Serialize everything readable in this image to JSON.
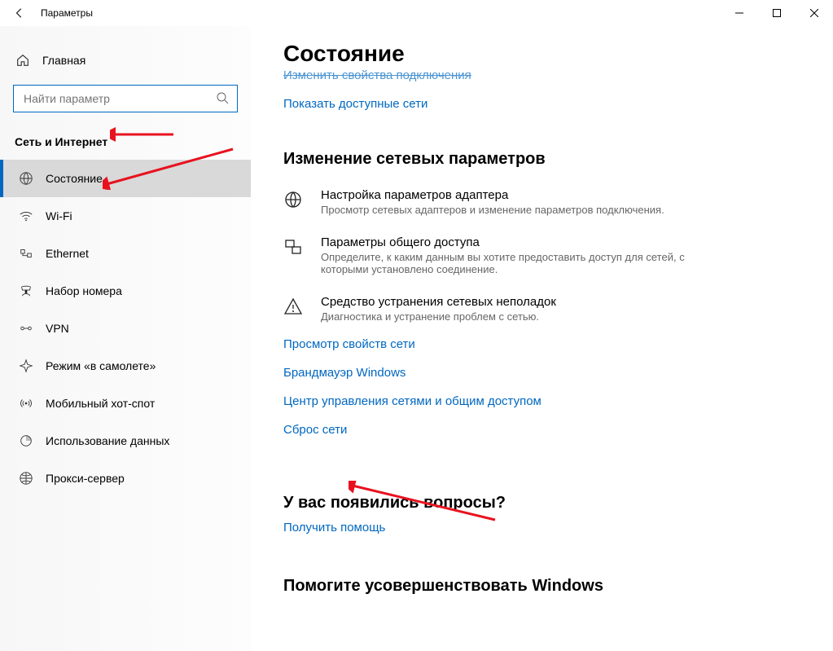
{
  "window": {
    "title": "Параметры"
  },
  "sidebar": {
    "home": "Главная",
    "search_placeholder": "Найти параметр",
    "category": "Сеть и Интернет",
    "items": [
      {
        "label": "Состояние",
        "icon": "status-icon",
        "active": true
      },
      {
        "label": "Wi-Fi",
        "icon": "wifi-icon",
        "active": false
      },
      {
        "label": "Ethernet",
        "icon": "ethernet-icon",
        "active": false
      },
      {
        "label": "Набор номера",
        "icon": "dialup-icon",
        "active": false
      },
      {
        "label": "VPN",
        "icon": "vpn-icon",
        "active": false
      },
      {
        "label": "Режим «в самолете»",
        "icon": "airplane-icon",
        "active": false
      },
      {
        "label": "Мобильный хот-спот",
        "icon": "hotspot-icon",
        "active": false
      },
      {
        "label": "Использование данных",
        "icon": "data-usage-icon",
        "active": false
      },
      {
        "label": "Прокси-сервер",
        "icon": "proxy-icon",
        "active": false
      }
    ]
  },
  "main": {
    "heading": "Состояние",
    "link_truncated": "Изменить свойства подключения",
    "link_show_networks": "Показать доступные сети",
    "change_settings_title": "Изменение сетевых параметров",
    "options": [
      {
        "title": "Настройка параметров адаптера",
        "desc": "Просмотр сетевых адаптеров и изменение параметров подключения."
      },
      {
        "title": "Параметры общего доступа",
        "desc": "Определите, к каким данным вы хотите предоставить доступ для сетей, с которыми установлено соединение."
      },
      {
        "title": "Средство устранения сетевых неполадок",
        "desc": "Диагностика и устранение проблем с сетью."
      }
    ],
    "links": [
      "Просмотр свойств сети",
      "Брандмауэр Windows",
      "Центр управления сетями и общим доступом",
      "Сброс сети"
    ],
    "questions_title": "У вас появились вопросы?",
    "get_help": "Получить помощь",
    "improve_title": "Помогите усовершенствовать Windows"
  },
  "colors": {
    "accent": "#0067c0",
    "link": "#0067c0"
  }
}
